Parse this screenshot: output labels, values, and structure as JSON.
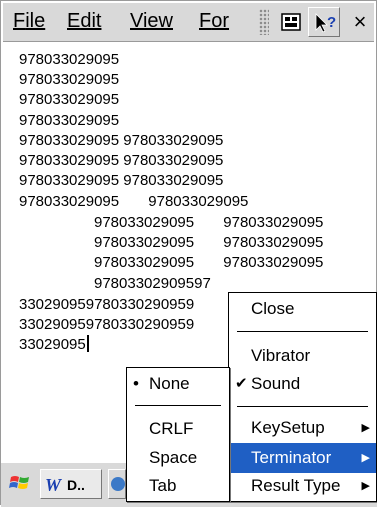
{
  "menubar": {
    "file": "File",
    "edit": "Edit",
    "view": "View",
    "format": "For"
  },
  "toolbar": {
    "close_glyph": "×"
  },
  "document": {
    "lines": [
      "978033029095",
      "978033029095",
      "978033029095",
      "978033029095",
      "978033029095 978033029095",
      "978033029095 978033029095",
      "978033029095 978033029095",
      "978033029095       978033029095",
      "978033029095       978033029095",
      "978033029095       978033029095",
      "978033029095       978033029095",
      "97803302909597",
      "330290959780330290959",
      "330290959780330290959",
      "33029095"
    ]
  },
  "taskbar": {
    "word_label": "D.."
  },
  "context_menu": {
    "close": "Close",
    "vibrator": "Vibrator",
    "sound": "Sound",
    "keysetup": "KeySetup",
    "terminator": "Terminator",
    "result_type": "Result Type",
    "check_glyph": "✔",
    "arrow_glyph": "▶"
  },
  "submenu": {
    "none": "None",
    "crlf": "CRLF",
    "space": "Space",
    "tab": "Tab",
    "bullet_glyph": "•"
  },
  "colors": {
    "highlight": "#1f5fc4",
    "menubar_bg": "#d9d9d9"
  }
}
